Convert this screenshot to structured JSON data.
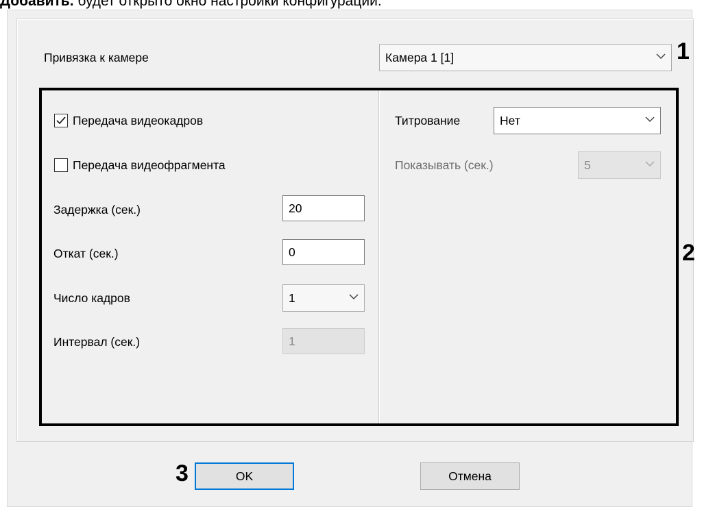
{
  "header": {
    "bold_word": "Добавить.",
    "rest_text": " будет открыто окно настройки конфигурации."
  },
  "camera": {
    "label": "Привязка к камере",
    "value": "Камера 1 [1]"
  },
  "left_panel": {
    "frames_checkbox": {
      "label": "Передача видеокадров",
      "checked": true
    },
    "fragment_checkbox": {
      "label": "Передача видеофрагмента",
      "checked": false
    },
    "delay": {
      "label": "Задержка (сек.)",
      "value": "20"
    },
    "rollback": {
      "label": "Откат (сек.)",
      "value": "0"
    },
    "frames_count": {
      "label": "Число кадров",
      "value": "1"
    },
    "interval": {
      "label": "Интервал (сек.)",
      "value": "1"
    }
  },
  "right_panel": {
    "titling": {
      "label": "Титрование",
      "value": "Нет"
    },
    "show": {
      "label": "Показывать (сек.)",
      "value": "5"
    }
  },
  "callouts": {
    "one": "1",
    "two": "2",
    "three": "3"
  },
  "buttons": {
    "ok": "OK",
    "cancel": "Отмена"
  },
  "colors": {
    "dialog_bg": "#f0f0f0",
    "annotation_border": "#000000",
    "ok_focus": "#0078d7"
  }
}
